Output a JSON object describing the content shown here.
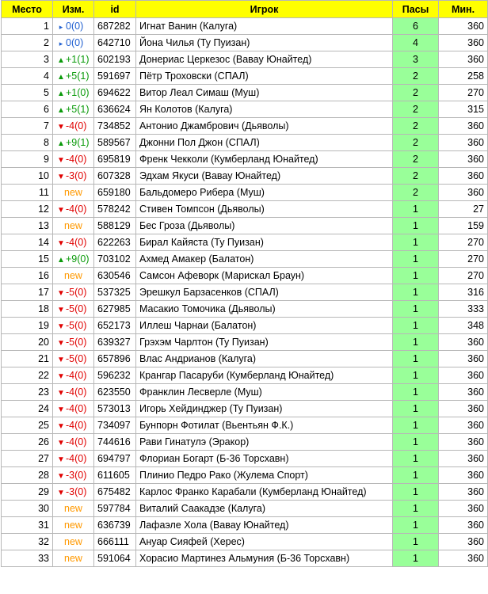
{
  "columns": {
    "place": "Место",
    "change": "Изм.",
    "id": "id",
    "player": "Игрок",
    "assists": "Пасы",
    "minutes": "Мин."
  },
  "colors": {
    "header_bg": "#ffff00",
    "assists_bg": "#99ff99",
    "up": "#0a9a0a",
    "down": "#e00000",
    "same": "#1f5fd0",
    "new": "#ff9900"
  },
  "icons": {
    "up": "triangle-up-icon",
    "down": "triangle-down-icon",
    "same": "triangle-right-icon"
  },
  "rows": [
    {
      "place": "1",
      "trend": "same",
      "change": "0(0)",
      "id": "687282",
      "player": "Игнат Ванин (Калуга)",
      "assists": "6",
      "minutes": "360"
    },
    {
      "place": "2",
      "trend": "same",
      "change": "0(0)",
      "id": "642710",
      "player": "Йона Чилья (Ту Пуизан)",
      "assists": "4",
      "minutes": "360"
    },
    {
      "place": "3",
      "trend": "up",
      "change": "+1(1)",
      "id": "602193",
      "player": "Донериас Церкезос (Вавау Юнайтед)",
      "assists": "3",
      "minutes": "360"
    },
    {
      "place": "4",
      "trend": "up",
      "change": "+5(1)",
      "id": "591697",
      "player": "Пётр Троховски (СПАЛ)",
      "assists": "2",
      "minutes": "258"
    },
    {
      "place": "5",
      "trend": "up",
      "change": "+1(0)",
      "id": "694622",
      "player": "Витор Леал Симаш (Муш)",
      "assists": "2",
      "minutes": "270"
    },
    {
      "place": "6",
      "trend": "up",
      "change": "+5(1)",
      "id": "636624",
      "player": "Ян Колотов (Калуга)",
      "assists": "2",
      "minutes": "315"
    },
    {
      "place": "7",
      "trend": "down",
      "change": "-4(0)",
      "id": "734852",
      "player": "Антонио Джамбрович (Дьяволы)",
      "assists": "2",
      "minutes": "360"
    },
    {
      "place": "8",
      "trend": "up",
      "change": "+9(1)",
      "id": "589567",
      "player": "Джонни Пол Джон (СПАЛ)",
      "assists": "2",
      "minutes": "360"
    },
    {
      "place": "9",
      "trend": "down",
      "change": "-4(0)",
      "id": "695819",
      "player": "Френк Чекколи (Кумберланд Юнайтед)",
      "assists": "2",
      "minutes": "360"
    },
    {
      "place": "10",
      "trend": "down",
      "change": "-3(0)",
      "id": "607328",
      "player": "Эдхам Якуси (Вавау Юнайтед)",
      "assists": "2",
      "minutes": "360"
    },
    {
      "place": "11",
      "trend": "new",
      "change": "new",
      "id": "659180",
      "player": "Бальдомеро Рибера (Муш)",
      "assists": "2",
      "minutes": "360"
    },
    {
      "place": "12",
      "trend": "down",
      "change": "-4(0)",
      "id": "578242",
      "player": "Стивен Томпсон (Дьяволы)",
      "assists": "1",
      "minutes": "27"
    },
    {
      "place": "13",
      "trend": "new",
      "change": "new",
      "id": "588129",
      "player": "Бес Гроза (Дьяволы)",
      "assists": "1",
      "minutes": "159"
    },
    {
      "place": "14",
      "trend": "down",
      "change": "-4(0)",
      "id": "622263",
      "player": "Бирал Кайяста (Ту Пуизан)",
      "assists": "1",
      "minutes": "270"
    },
    {
      "place": "15",
      "trend": "up",
      "change": "+9(0)",
      "id": "703102",
      "player": "Ахмед Амакер (Балатон)",
      "assists": "1",
      "minutes": "270"
    },
    {
      "place": "16",
      "trend": "new",
      "change": "new",
      "id": "630546",
      "player": "Самсон Афеворк (Марискал Браун)",
      "assists": "1",
      "minutes": "270"
    },
    {
      "place": "17",
      "trend": "down",
      "change": "-5(0)",
      "id": "537325",
      "player": "Эрешкул Барзасенков (СПАЛ)",
      "assists": "1",
      "minutes": "316"
    },
    {
      "place": "18",
      "trend": "down",
      "change": "-5(0)",
      "id": "627985",
      "player": "Масакио Томочика (Дьяволы)",
      "assists": "1",
      "minutes": "333"
    },
    {
      "place": "19",
      "trend": "down",
      "change": "-5(0)",
      "id": "652173",
      "player": "Иллеш Чарнаи (Балатон)",
      "assists": "1",
      "minutes": "348"
    },
    {
      "place": "20",
      "trend": "down",
      "change": "-5(0)",
      "id": "639327",
      "player": "Грэхэм Чарлтон (Ту Пуизан)",
      "assists": "1",
      "minutes": "360"
    },
    {
      "place": "21",
      "trend": "down",
      "change": "-5(0)",
      "id": "657896",
      "player": "Влас Андрианов (Калуга)",
      "assists": "1",
      "minutes": "360"
    },
    {
      "place": "22",
      "trend": "down",
      "change": "-4(0)",
      "id": "596232",
      "player": "Крангар Пасаруби (Кумберланд Юнайтед)",
      "assists": "1",
      "minutes": "360"
    },
    {
      "place": "23",
      "trend": "down",
      "change": "-4(0)",
      "id": "623550",
      "player": "Франклин Лесверле (Муш)",
      "assists": "1",
      "minutes": "360"
    },
    {
      "place": "24",
      "trend": "down",
      "change": "-4(0)",
      "id": "573013",
      "player": "Игорь Хейдинджер (Ту Пуизан)",
      "assists": "1",
      "minutes": "360"
    },
    {
      "place": "25",
      "trend": "down",
      "change": "-4(0)",
      "id": "734097",
      "player": "Бунпорн Фотилат (Вьентьян Ф.К.)",
      "assists": "1",
      "minutes": "360"
    },
    {
      "place": "26",
      "trend": "down",
      "change": "-4(0)",
      "id": "744616",
      "player": "Рави Гинатулэ (Эракор)",
      "assists": "1",
      "minutes": "360"
    },
    {
      "place": "27",
      "trend": "down",
      "change": "-4(0)",
      "id": "694797",
      "player": "Флориан Богарт (Б-36 Торсхавн)",
      "assists": "1",
      "minutes": "360"
    },
    {
      "place": "28",
      "trend": "down",
      "change": "-3(0)",
      "id": "611605",
      "player": "Плинио Педро Рако (Жулема Спорт)",
      "assists": "1",
      "minutes": "360"
    },
    {
      "place": "29",
      "trend": "down",
      "change": "-3(0)",
      "id": "675482",
      "player": "Карлос Франко Карабали (Кумберланд Юнайтед)",
      "assists": "1",
      "minutes": "360"
    },
    {
      "place": "30",
      "trend": "new",
      "change": "new",
      "id": "597784",
      "player": "Виталий Саакадзе (Калуга)",
      "assists": "1",
      "minutes": "360"
    },
    {
      "place": "31",
      "trend": "new",
      "change": "new",
      "id": "636739",
      "player": "Лафаэле Хола (Вавау Юнайтед)",
      "assists": "1",
      "minutes": "360"
    },
    {
      "place": "32",
      "trend": "new",
      "change": "new",
      "id": "666111",
      "player": "Ануар Сияфей (Херес)",
      "assists": "1",
      "minutes": "360"
    },
    {
      "place": "33",
      "trend": "new",
      "change": "new",
      "id": "591064",
      "player": "Хорасио Мартинез Альмуния (Б-36 Торсхавн)",
      "assists": "1",
      "minutes": "360"
    }
  ]
}
